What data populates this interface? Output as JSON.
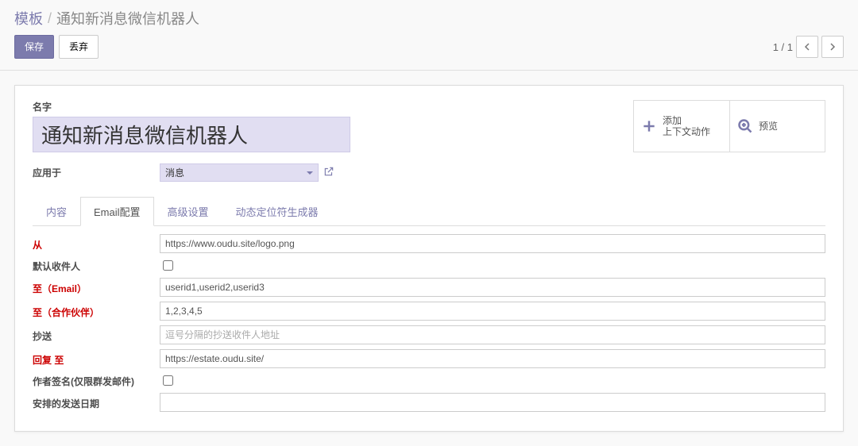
{
  "breadcrumb": {
    "root": "模板",
    "current": "通知新消息微信机器人"
  },
  "toolbar": {
    "save": "保存",
    "discard": "丢弃"
  },
  "pager": {
    "text": "1 / 1"
  },
  "status_buttons": {
    "add_context": {
      "line1": "添加",
      "line2": "上下文动作"
    },
    "preview": {
      "label": "预览"
    }
  },
  "name": {
    "label": "名字",
    "value": "通知新消息微信机器人"
  },
  "apply": {
    "label": "应用于",
    "value": "消息"
  },
  "tabs": {
    "content": "内容",
    "email": "Email配置",
    "advanced": "高级设置",
    "placeholder": "动态定位符生成器"
  },
  "fields": {
    "from": {
      "label": "从",
      "value": "https://www.oudu.site/logo.png"
    },
    "default_to": {
      "label": "默认收件人"
    },
    "to_email": {
      "label": "至（Email）",
      "value": "userid1,userid2,userid3"
    },
    "to_partner": {
      "label": "至（合作伙伴）",
      "value": "1,2,3,4,5"
    },
    "cc": {
      "label": "抄送",
      "placeholder": "逗号分隔的抄送收件人地址",
      "value": ""
    },
    "reply_to": {
      "label": "回复 至",
      "value": "https://estate.oudu.site/"
    },
    "signature": {
      "label": "作者签名(仅限群发邮件)"
    },
    "schedule": {
      "label": "安排的发送日期",
      "value": ""
    }
  }
}
